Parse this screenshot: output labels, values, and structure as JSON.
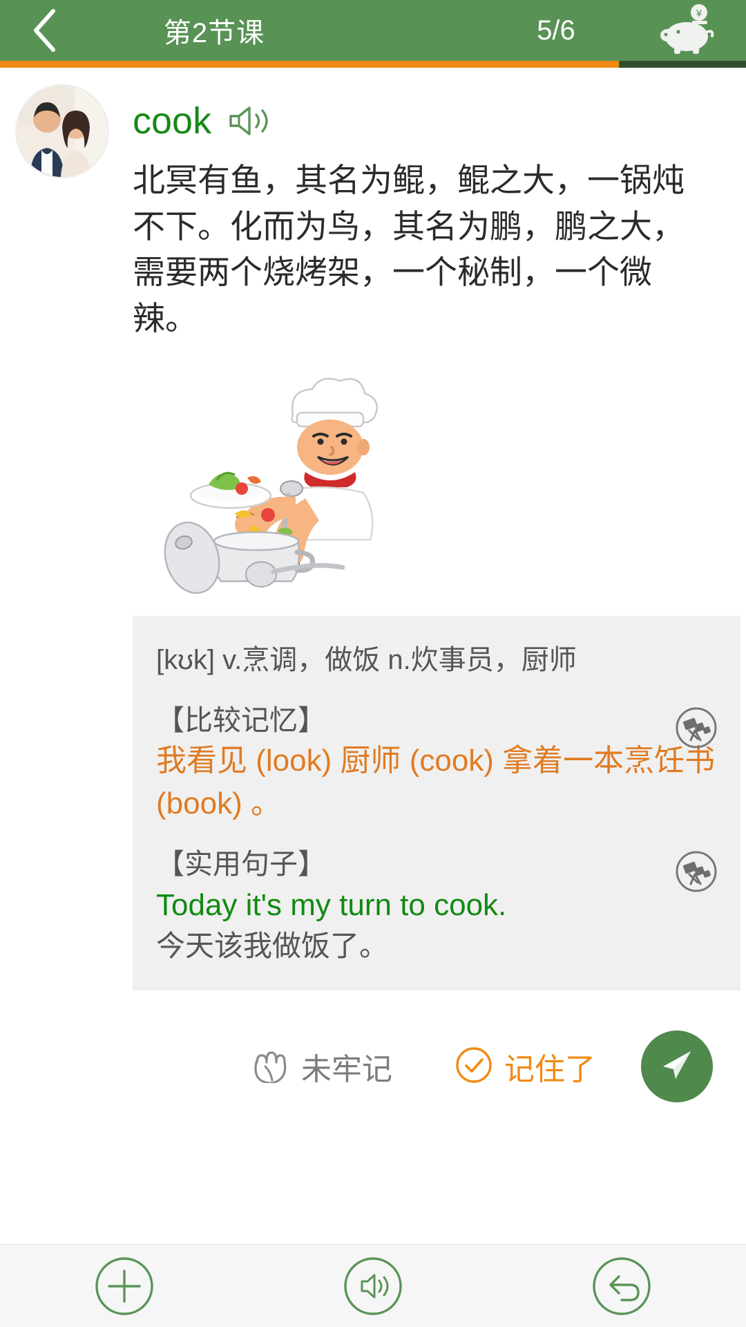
{
  "header": {
    "back_icon": "chevron-left-icon",
    "title": "第2节课",
    "count": "5/6",
    "piggy_icon": "piggy-bank-icon",
    "bg_color": "#589255",
    "progress_fill_color": "#f08a14",
    "progress_track_color": "#2f4f2d",
    "progress_percent": 83
  },
  "card": {
    "avatar_name": "user-avatar-couple-photo",
    "word": "cook",
    "word_color": "#178a17",
    "speaker_icon": "speaker-icon",
    "paragraph": "北冥有鱼，其名为鲲，鲲之大，一锅炖不下。化而为鸟，其名为鹏，鹏之大，需要两个烧烤架，一个秘制，一个微辣。",
    "illustration_name": "chef-cooking-illustration"
  },
  "definition": {
    "phonetic_and_meaning": "[kʊk] v.烹调，做饭 n.炊事员，厨师",
    "sections": [
      {
        "head": "【比较记忆】",
        "body": "我看见 (look) 厨师 (cook) 拿着一本烹饪书 (book) 。",
        "body_color": "#e07b22",
        "action_icon": "telescope-icon"
      },
      {
        "head": "【实用句子】",
        "body_en": "Today it's my turn to cook.",
        "body_en_color": "#118a11",
        "body_cn": "今天该我做饭了。",
        "action_icon": "telescope-icon"
      }
    ]
  },
  "actions": {
    "not_memorized_icon": "fist-icon",
    "not_memorized_label": "未牢记",
    "memorized_icon": "check-circle-icon",
    "memorized_label": "记住了",
    "send_icon": "paper-plane-icon",
    "send_bg_color": "#4f8a4c"
  },
  "toolbar": {
    "items": [
      {
        "icon": "plus-circle-icon"
      },
      {
        "icon": "speaker-circle-icon"
      },
      {
        "icon": "undo-circle-icon"
      }
    ],
    "accent_color": "#5a9457"
  }
}
